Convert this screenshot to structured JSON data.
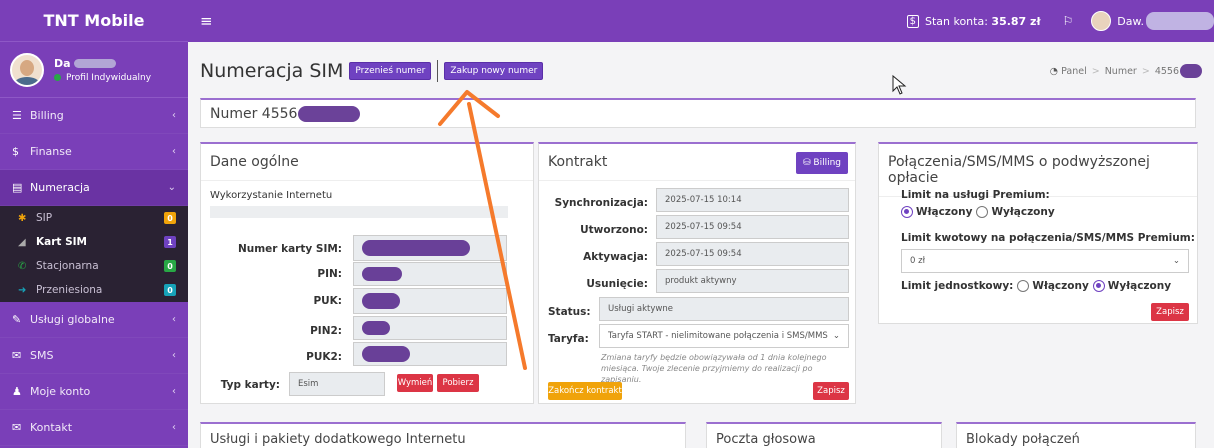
{
  "brand": "TNT Mobile",
  "user": {
    "name": "Da",
    "profile": "Profil Indywidualny"
  },
  "nav": [
    {
      "icon": "☰",
      "label": "Billing"
    },
    {
      "icon": "$",
      "label": "Finanse"
    },
    {
      "icon": "☰",
      "label": "Numeracja"
    }
  ],
  "subnav": [
    {
      "label": "SIP",
      "badge": "0",
      "color": "#f0a30a"
    },
    {
      "label": "Kart SIM",
      "badge": "1",
      "color": "#6f42c1"
    },
    {
      "label": "Stacjonarna",
      "badge": "0",
      "color": "#28a745"
    },
    {
      "label": "Przeniesiona",
      "badge": "0",
      "color": "#17a2b8"
    }
  ],
  "nav2": [
    {
      "label": "Usługi globalne"
    },
    {
      "label": "SMS"
    },
    {
      "label": "Moje konto"
    },
    {
      "label": "Kontakt"
    }
  ],
  "topbar": {
    "balance_label": "Stan konta:",
    "balance_value": "35.87 zł",
    "user_short": "Daw."
  },
  "page": {
    "title": "Numeracja SIM",
    "btn_transfer": "Przenieś numer",
    "btn_buy": "Zakup nowy numer"
  },
  "breadcrumb": {
    "home": "Panel",
    "level1": "Numer",
    "level2": "4556"
  },
  "number_header": "Numer 4556",
  "general": {
    "title": "Dane ogólne",
    "internet_label": "Wykorzystanie Internetu",
    "fields": [
      {
        "label": "Numer karty SIM:"
      },
      {
        "label": "PIN:"
      },
      {
        "label": "PUK:"
      },
      {
        "label": "PIN2:"
      },
      {
        "label": "PUK2:"
      }
    ],
    "card_type_label": "Typ karty:",
    "card_type_value": "Esim",
    "btn_replace": "Wymień",
    "btn_download": "Pobierz"
  },
  "contract": {
    "title": "Kontrakt",
    "billing_btn": "Billing",
    "sync_label": "Synchronizacja:",
    "sync_value": "2025-07-15 10:14",
    "created_label": "Utworzono:",
    "created_value": "2025-07-15 09:54",
    "activation_label": "Aktywacja:",
    "activation_value": "2025-07-15 09:54",
    "deletion_label": "Usunięcie:",
    "deletion_value": "produkt aktywny",
    "status_label": "Status:",
    "status_value": "Usługi aktywne",
    "tariff_label": "Taryfa:",
    "tariff_value": "Taryfa START - nielimitowane połączenia i SMS/MMS w",
    "note": "Zmiana taryfy będzie obowiązywała od 1 dnia kolejnego miesiąca. Twoje zlecenie przyjmiemy do realizacji po zapisaniu.",
    "btn_end": "Zakończ kontrakt",
    "btn_save": "Zapisz"
  },
  "premium": {
    "title": "Połączenia/SMS/MMS o podwyższonej opłacie",
    "limit_services_label": "Limit na usługi Premium:",
    "on_label": "Włączony",
    "off_label": "Wyłączony",
    "limit_amount_label": "Limit kwotowy na połączenia/SMS/MMS Premium:",
    "limit_amount_value": "0 zł",
    "limit_unit_label": "Limit jednostkowy:",
    "btn_save": "Zapisz"
  },
  "bottom": {
    "services": "Usługi i pakiety dodatkowego Internetu",
    "voicemail": "Poczta głosowa",
    "blocks": "Blokady połączeń"
  }
}
